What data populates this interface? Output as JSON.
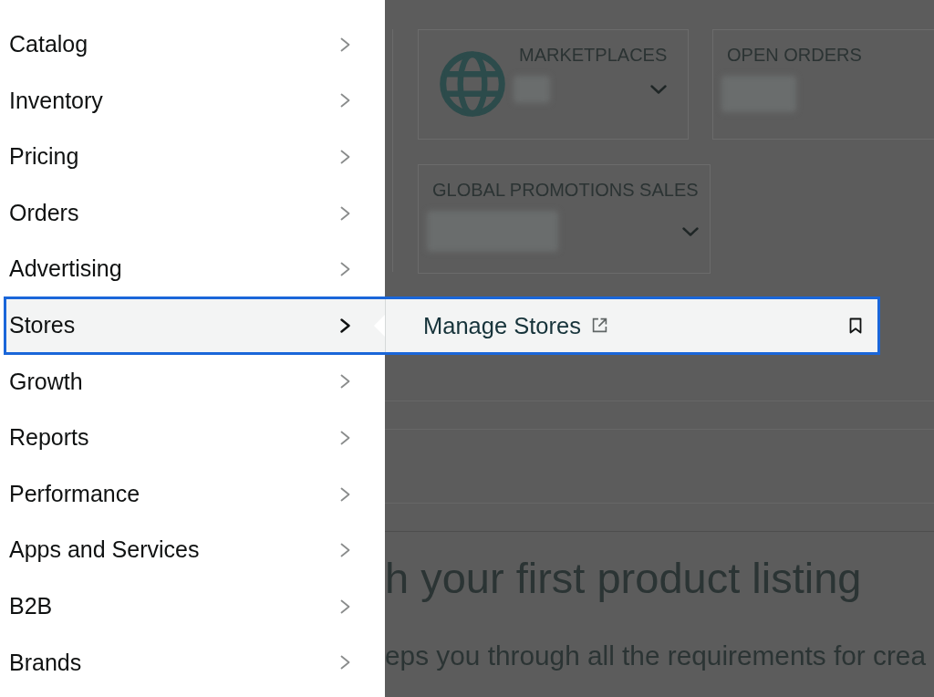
{
  "menu": {
    "items": [
      {
        "label": "Catalog",
        "selected": false
      },
      {
        "label": "Inventory",
        "selected": false
      },
      {
        "label": "Pricing",
        "selected": false
      },
      {
        "label": "Orders",
        "selected": false
      },
      {
        "label": "Advertising",
        "selected": false
      },
      {
        "label": "Stores",
        "selected": true
      },
      {
        "label": "Growth",
        "selected": false
      },
      {
        "label": "Reports",
        "selected": false
      },
      {
        "label": "Performance",
        "selected": false
      },
      {
        "label": "Apps and Services",
        "selected": false
      },
      {
        "label": "B2B",
        "selected": false
      },
      {
        "label": "Brands",
        "selected": false
      }
    ]
  },
  "flyout": {
    "items": [
      {
        "label": "Manage Stores",
        "external": true,
        "bookmarked": false
      }
    ]
  },
  "dashboard": {
    "card_rows": [
      [
        {
          "title": "MARKETPLACES",
          "kind": "globe",
          "dropdown": true
        },
        {
          "title": "OPEN ORDERS",
          "kind": "plain",
          "dropdown": false
        }
      ],
      [
        {
          "title": "GLOBAL PROMOTIONS SALES",
          "kind": "plain",
          "dropdown": true
        }
      ]
    ],
    "heading": "h your first product listing",
    "intro": "eps you through all the requirements for crea"
  }
}
